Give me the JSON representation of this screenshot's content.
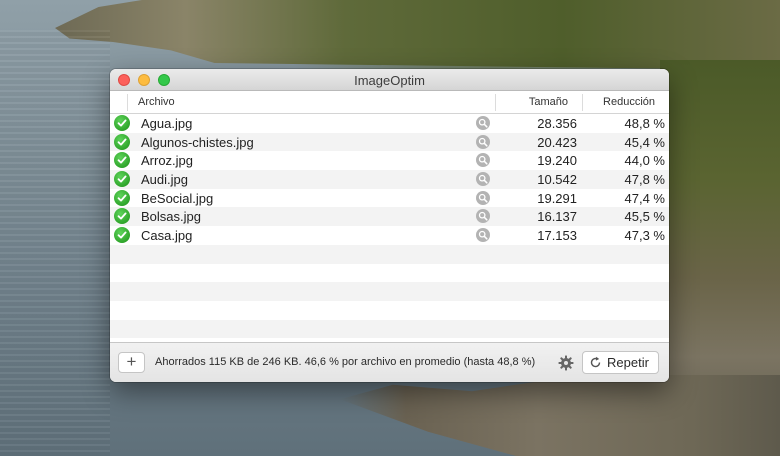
{
  "window": {
    "title": "ImageOptim"
  },
  "table": {
    "headers": {
      "file": "Archivo",
      "size": "Tamaño",
      "reduction": "Reducción"
    },
    "rows": [
      {
        "status": "done",
        "file": "Agua.jpg",
        "size": "28.356",
        "reduction": "48,8 %"
      },
      {
        "status": "done",
        "file": "Algunos-chistes.jpg",
        "size": "20.423",
        "reduction": "45,4 %"
      },
      {
        "status": "done",
        "file": "Arroz.jpg",
        "size": "19.240",
        "reduction": "44,0 %"
      },
      {
        "status": "done",
        "file": "Audi.jpg",
        "size": "10.542",
        "reduction": "47,8 %"
      },
      {
        "status": "done",
        "file": "BeSocial.jpg",
        "size": "19.291",
        "reduction": "47,4 %"
      },
      {
        "status": "done",
        "file": "Bolsas.jpg",
        "size": "16.137",
        "reduction": "45,5 %"
      },
      {
        "status": "done",
        "file": "Casa.jpg",
        "size": "17.153",
        "reduction": "47,3 %"
      }
    ]
  },
  "bottombar": {
    "add_label": "+",
    "status": "Ahorrados 115 KB de 246 KB. 46,6 % por archivo en promedio (hasta 48,8 %)",
    "repeat_label": "Repetir"
  },
  "icons": {
    "status_ok": "checkmark-circle-icon",
    "preview": "magnifier-icon",
    "settings": "gear-icon",
    "repeat": "refresh-icon"
  },
  "colors": {
    "check_green": "#2fa52b",
    "close": "#fc605b",
    "minimize": "#fdbc40",
    "zoom": "#34c84a"
  }
}
